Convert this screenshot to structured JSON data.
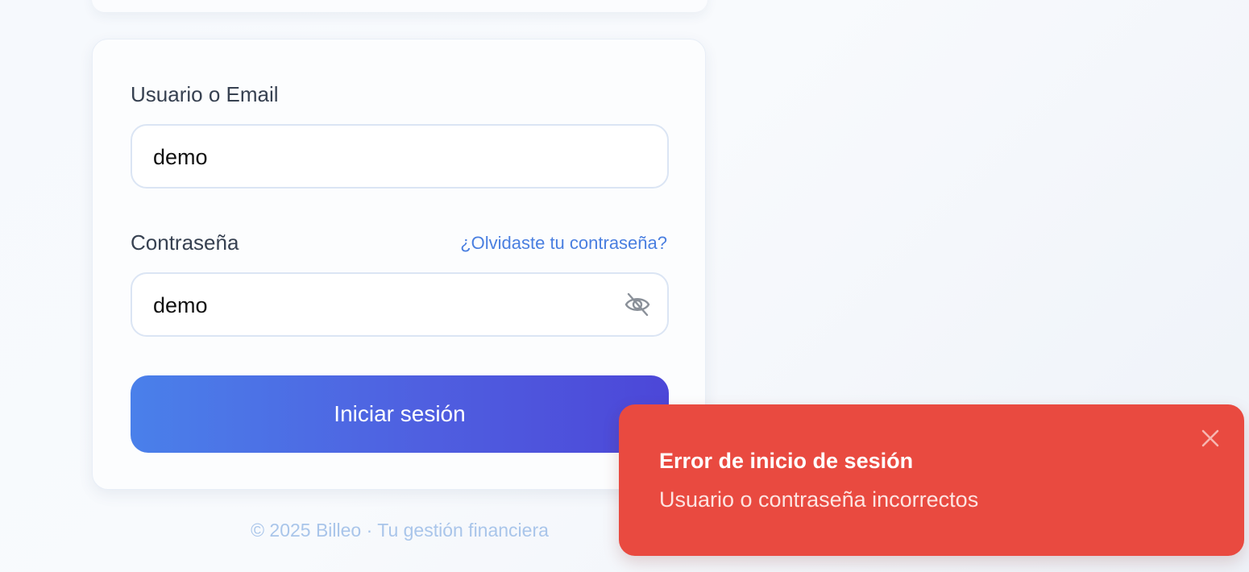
{
  "login_form": {
    "username_label": "Usuario o Email",
    "username_value": "demo",
    "password_label": "Contraseña",
    "forgot_password_link": "¿Olvidaste tu contraseña?",
    "password_value": "demo",
    "password_visibility_icon": "eye-off-icon",
    "submit_label": "Iniciar sesión"
  },
  "footer": {
    "text": "© 2025 Billeo · Tu gestión financiera"
  },
  "toast": {
    "title": "Error de inicio de sesión",
    "message": "Usuario o contraseña incorrectos",
    "close_icon": "close-icon"
  },
  "colors": {
    "accent_start": "#4a80ea",
    "accent_end": "#4c47d8",
    "link": "#4a7fe0",
    "error": "#e94a40",
    "footer_text": "#a9c5ea"
  }
}
